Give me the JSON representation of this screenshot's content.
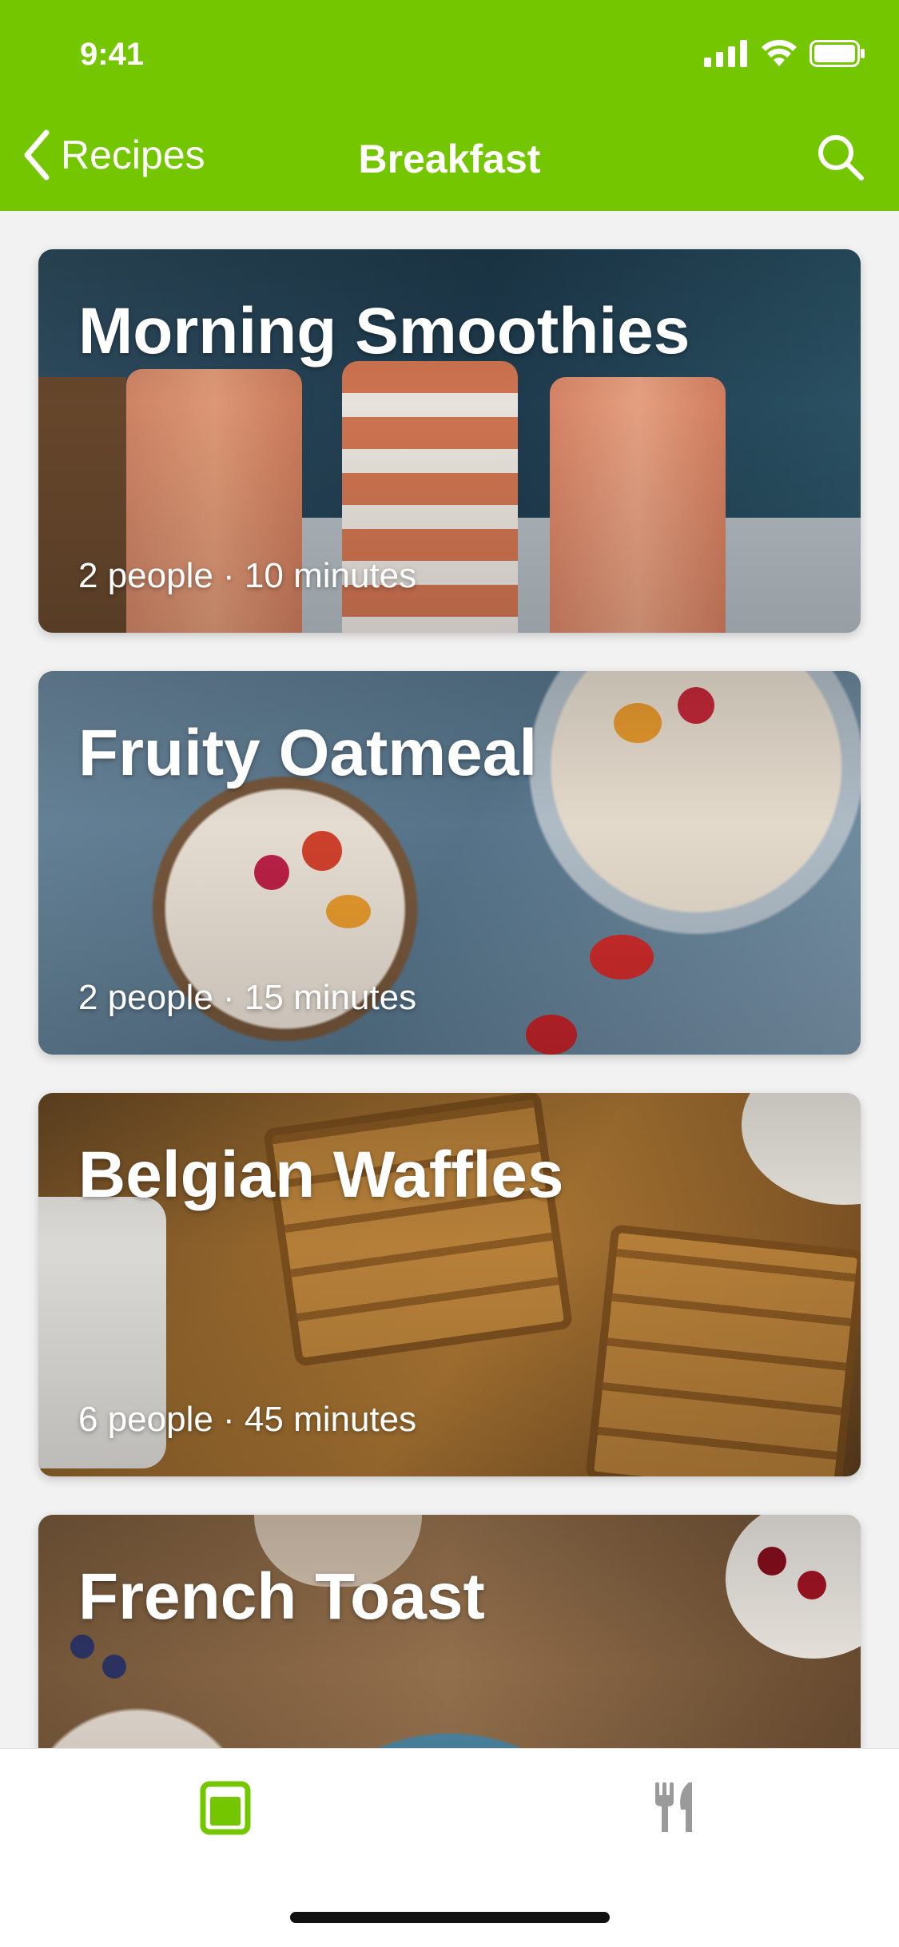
{
  "status_bar": {
    "time": "9:41"
  },
  "nav": {
    "back_label": "Recipes",
    "title": "Breakfast"
  },
  "recipes": [
    {
      "title": "Morning Smoothies",
      "meta": "2 people · 10 minutes"
    },
    {
      "title": "Fruity Oatmeal",
      "meta": "2 people · 15 minutes"
    },
    {
      "title": "Belgian Waffles",
      "meta": "6 people · 45 minutes"
    },
    {
      "title": "French Toast",
      "meta": ""
    }
  ],
  "tabbar": {
    "tabs": [
      "book-icon",
      "cutlery-icon"
    ],
    "active_color": "#74c700",
    "inactive_color": "#9a9a9a"
  },
  "colors": {
    "header": "#74c700"
  }
}
